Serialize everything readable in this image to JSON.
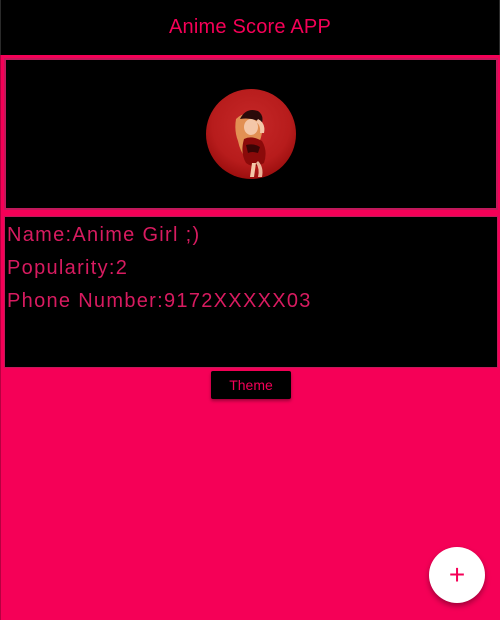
{
  "appbar": {
    "title": "Anime Score APP"
  },
  "profile": {
    "avatar_icon": "anime-girl-avatar",
    "name_line": "Name:Anime Girl ;)",
    "popularity_line": "Popularity:2",
    "phone_line": "Phone Number:9172XXXXX03"
  },
  "actions": {
    "theme_label": "Theme",
    "fab_icon": "plus-icon",
    "fab_glyph": "+"
  },
  "colors": {
    "accent": "#f50057",
    "surface": "#000000",
    "fab_background": "#ffffff"
  }
}
